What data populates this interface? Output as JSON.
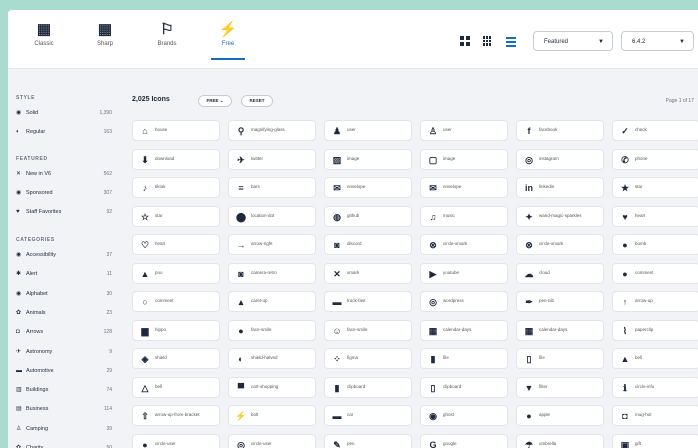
{
  "top_tabs": [
    {
      "label": "Classic",
      "icon": "▦",
      "icon_name": "classic-icon"
    },
    {
      "label": "Sharp",
      "icon": "▦",
      "icon_name": "sharp-icon"
    },
    {
      "label": "Brands",
      "icon": "⚐",
      "icon_name": "flag-icon"
    },
    {
      "label": "Free",
      "icon": "⚡",
      "icon_name": "bolt-icon"
    }
  ],
  "sort": {
    "value": "Featured"
  },
  "version": {
    "value": "6.4.2"
  },
  "sidebar": {
    "style_heading": "STYLE",
    "style": [
      {
        "label": "Solid",
        "count": "1,390",
        "icon": "◉"
      },
      {
        "label": "Regular",
        "count": "163",
        "icon": "◐"
      }
    ],
    "featured_heading": "FEATURED",
    "featured": [
      {
        "label": "New in V6",
        "count": "562",
        "icon": "✕"
      },
      {
        "label": "Sponsored",
        "count": "307",
        "icon": "◉"
      },
      {
        "label": "Staff Favorites",
        "count": "92",
        "icon": "♥"
      }
    ],
    "categories_heading": "CATEGORIES",
    "categories": [
      {
        "label": "Accessibility",
        "count": "37",
        "icon": "◉"
      },
      {
        "label": "Alert",
        "count": "11",
        "icon": "✱"
      },
      {
        "label": "Alphabet",
        "count": "30",
        "icon": "◉"
      },
      {
        "label": "Animals",
        "count": "23",
        "icon": "✿"
      },
      {
        "label": "Arrows",
        "count": "128",
        "icon": "◘"
      },
      {
        "label": "Astronomy",
        "count": "9",
        "icon": "✈"
      },
      {
        "label": "Automotive",
        "count": "29",
        "icon": "▬"
      },
      {
        "label": "Buildings",
        "count": "74",
        "icon": "▥"
      },
      {
        "label": "Business",
        "count": "114",
        "icon": "▤"
      },
      {
        "label": "Camping",
        "count": "39",
        "icon": "♙"
      },
      {
        "label": "Charity",
        "count": "50",
        "icon": "✿"
      }
    ]
  },
  "main": {
    "count_label": "2,025 Icons",
    "filter_label": "FREE",
    "reset_label": "RESET",
    "page_info": "Page 1 of 17",
    "icons": [
      {
        "label": "house",
        "icon": "⌂"
      },
      {
        "label": "magnifying-glass",
        "icon": "⚲"
      },
      {
        "label": "user",
        "icon": "♟"
      },
      {
        "label": "user",
        "icon": "♙"
      },
      {
        "label": "facebook",
        "icon": "f"
      },
      {
        "label": "check",
        "icon": "✓"
      },
      {
        "label": "download",
        "icon": "⬇"
      },
      {
        "label": "twitter",
        "icon": "✈"
      },
      {
        "label": "image",
        "icon": "▨"
      },
      {
        "label": "image",
        "icon": "▢"
      },
      {
        "label": "instagram",
        "icon": "◎"
      },
      {
        "label": "phone",
        "icon": "✆"
      },
      {
        "label": "tiktok",
        "icon": "♪"
      },
      {
        "label": "bars",
        "icon": "≡"
      },
      {
        "label": "envelope",
        "icon": "✉"
      },
      {
        "label": "envelope",
        "icon": "✉"
      },
      {
        "label": "linkedin",
        "icon": "in"
      },
      {
        "label": "star",
        "icon": "★"
      },
      {
        "label": "star",
        "icon": "☆"
      },
      {
        "label": "location-dot",
        "icon": "⬤"
      },
      {
        "label": "github",
        "icon": "◍"
      },
      {
        "label": "music",
        "icon": "♫"
      },
      {
        "label": "wand-magic-sparkles",
        "icon": "✦"
      },
      {
        "label": "heart",
        "icon": "♥"
      },
      {
        "label": "heart",
        "icon": "♡"
      },
      {
        "label": "arrow-right",
        "icon": "→"
      },
      {
        "label": "discord",
        "icon": "◙"
      },
      {
        "label": "circle-xmark",
        "icon": "⊗"
      },
      {
        "label": "circle-xmark",
        "icon": "⊗"
      },
      {
        "label": "bomb",
        "icon": "●"
      },
      {
        "label": "poo",
        "icon": "▲"
      },
      {
        "label": "camera-retro",
        "icon": "◙"
      },
      {
        "label": "xmark",
        "icon": "✕"
      },
      {
        "label": "youtube",
        "icon": "▶"
      },
      {
        "label": "cloud",
        "icon": "☁"
      },
      {
        "label": "comment",
        "icon": "●"
      },
      {
        "label": "comment",
        "icon": "○"
      },
      {
        "label": "caret-up",
        "icon": "▴"
      },
      {
        "label": "truck-fast",
        "icon": "▬"
      },
      {
        "label": "wordpress",
        "icon": "◎"
      },
      {
        "label": "pen-nib",
        "icon": "✒"
      },
      {
        "label": "arrow-up",
        "icon": "↑"
      },
      {
        "label": "hippo",
        "icon": "▆"
      },
      {
        "label": "face-smile",
        "icon": "●"
      },
      {
        "label": "face-smile",
        "icon": "☺"
      },
      {
        "label": "calendar-days",
        "icon": "▦"
      },
      {
        "label": "calendar-days",
        "icon": "▦"
      },
      {
        "label": "paperclip",
        "icon": "⌇"
      },
      {
        "label": "shield",
        "icon": "◈"
      },
      {
        "label": "shield-halved",
        "icon": "◐"
      },
      {
        "label": "figma",
        "icon": "⁘"
      },
      {
        "label": "file",
        "icon": "▮"
      },
      {
        "label": "file",
        "icon": "▯"
      },
      {
        "label": "bell",
        "icon": "▲"
      },
      {
        "label": "bell",
        "icon": "△"
      },
      {
        "label": "cart-shopping",
        "icon": "▀"
      },
      {
        "label": "clipboard",
        "icon": "▮"
      },
      {
        "label": "clipboard",
        "icon": "▯"
      },
      {
        "label": "filter",
        "icon": "▼"
      },
      {
        "label": "circle-info",
        "icon": "ℹ"
      },
      {
        "label": "arrow-up-from-bracket",
        "icon": "⇧"
      },
      {
        "label": "bolt",
        "icon": "⚡"
      },
      {
        "label": "car",
        "icon": "▬"
      },
      {
        "label": "ghost",
        "icon": "◉"
      },
      {
        "label": "apple",
        "icon": "●"
      },
      {
        "label": "mug-hot",
        "icon": "◘"
      },
      {
        "label": "circle-user",
        "icon": "●"
      },
      {
        "label": "circle-user",
        "icon": "◎"
      },
      {
        "label": "pen",
        "icon": "✎"
      },
      {
        "label": "google",
        "icon": "G"
      },
      {
        "label": "umbrella",
        "icon": "☂"
      },
      {
        "label": "gift",
        "icon": "▣"
      }
    ]
  },
  "colors": {
    "accent": "#146ebe",
    "text": "#1e293b",
    "panel": "#f1f3f6",
    "backdrop": "#a9dccf"
  }
}
